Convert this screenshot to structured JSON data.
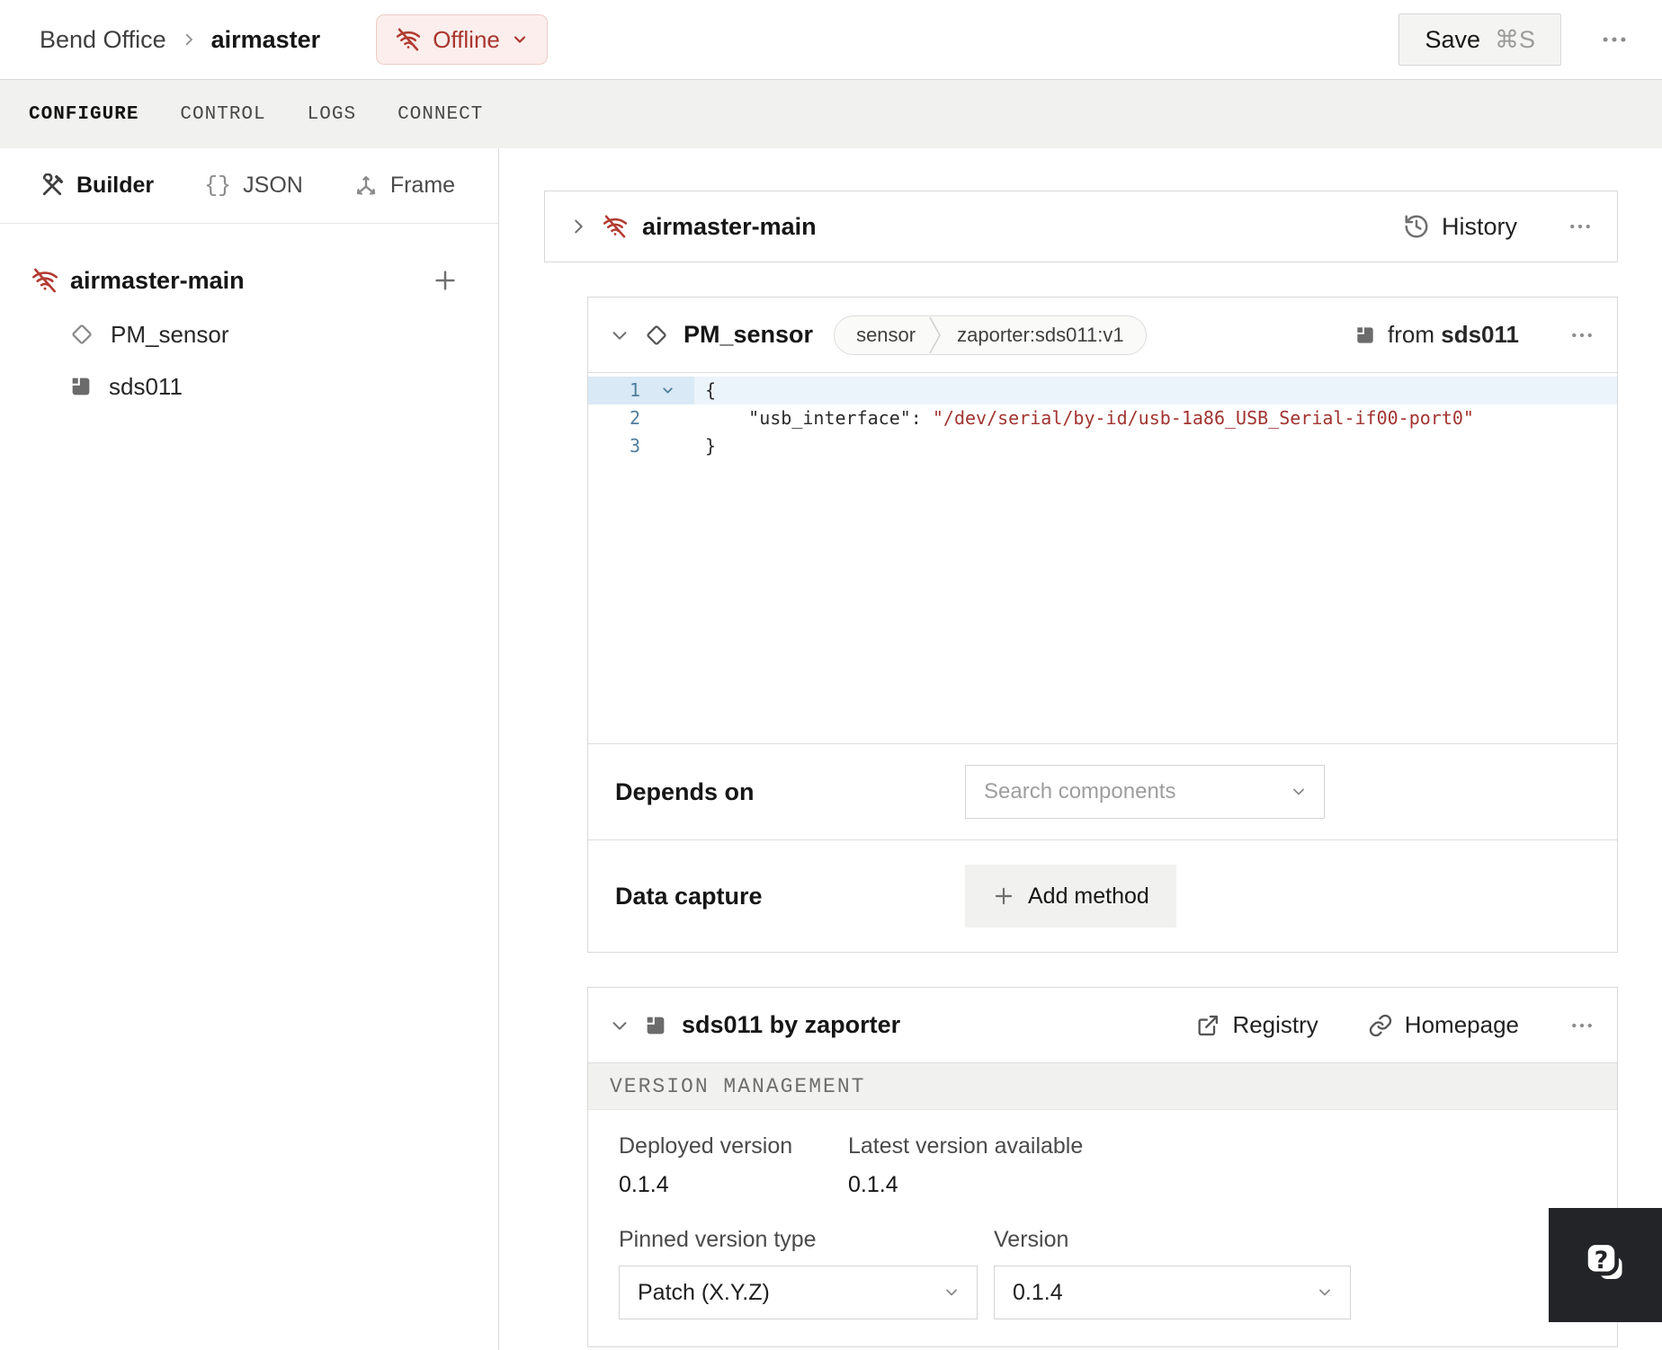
{
  "topbar": {
    "breadcrumb_parent": "Bend Office",
    "breadcrumb_current": "airmaster",
    "status_label": "Offline",
    "save_label": "Save",
    "save_shortcut": "⌘S"
  },
  "tabs": {
    "items": [
      {
        "label": "CONFIGURE",
        "active": true
      },
      {
        "label": "CONTROL",
        "active": false
      },
      {
        "label": "LOGS",
        "active": false
      },
      {
        "label": "CONNECT",
        "active": false
      }
    ]
  },
  "sidebar": {
    "views": [
      {
        "label": "Builder",
        "active": true
      },
      {
        "label": "JSON",
        "active": false,
        "glyph": "{}"
      },
      {
        "label": "Frame",
        "active": false
      }
    ],
    "tree": {
      "machine": "airmaster-main",
      "add_glyph": "+",
      "children": [
        {
          "label": "PM_sensor",
          "icon": "component-diamond"
        },
        {
          "label": "sds011",
          "icon": "module"
        }
      ]
    }
  },
  "machine_card": {
    "name": "airmaster-main",
    "history_label": "History"
  },
  "component_card": {
    "name": "PM_sensor",
    "type_badge": "sensor",
    "model_badge": "zaporter:sds011:v1",
    "from_prefix": "from",
    "from_module": "sds011",
    "code": {
      "line1": {
        "num": "1",
        "text": "{"
      },
      "line2": {
        "num": "2",
        "indent": "    ",
        "key": "\"usb_interface\"",
        "sep": ": ",
        "value": "\"/dev/serial/by-id/usb-1a86_USB_Serial-if00-port0\""
      },
      "line3": {
        "num": "3",
        "text": "}"
      }
    },
    "depends_on_label": "Depends on",
    "depends_on_placeholder": "Search components",
    "data_capture_label": "Data capture",
    "add_method_label": "Add method"
  },
  "module_card": {
    "title": "sds011 by zaporter",
    "registry_label": "Registry",
    "homepage_label": "Homepage",
    "section_title": "VERSION MANAGEMENT",
    "deployed_version_label": "Deployed version",
    "deployed_version": "0.1.4",
    "latest_version_label": "Latest version available",
    "latest_version": "0.1.4",
    "pinned_type_label": "Pinned version type",
    "pinned_type_value": "Patch (X.Y.Z)",
    "version_label": "Version",
    "version_value": "0.1.4"
  },
  "colors": {
    "offline_red": "#a8362f",
    "code_string_red": "#a23431",
    "code_line_number_blue": "#4f7e9c",
    "tab_bar_gray": "#f1f1ef"
  }
}
